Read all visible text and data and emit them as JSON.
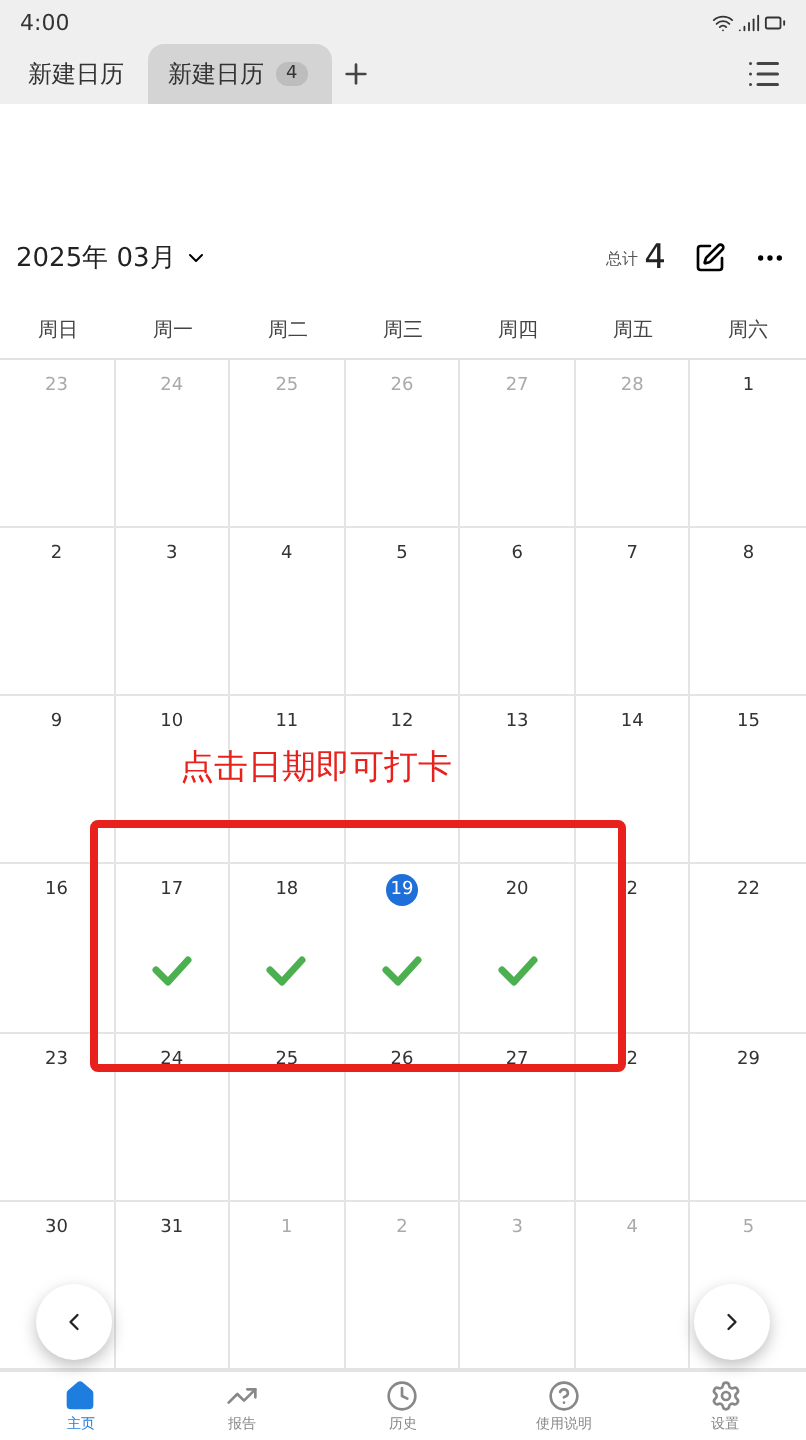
{
  "status_bar": {
    "time": "4:00"
  },
  "tabs": [
    {
      "label": "新建日历",
      "selected": false
    },
    {
      "label": "新建日历",
      "badge": "4",
      "selected": true
    }
  ],
  "header": {
    "month": "2025年 03月",
    "total_label": "总计",
    "total": "4"
  },
  "weekdays": [
    "周日",
    "周一",
    "周二",
    "周三",
    "周四",
    "周五",
    "周六"
  ],
  "weeks": [
    [
      {
        "day": "23",
        "in_month": false,
        "today": false,
        "checked": false
      },
      {
        "day": "24",
        "in_month": false,
        "today": false,
        "checked": false
      },
      {
        "day": "25",
        "in_month": false,
        "today": false,
        "checked": false
      },
      {
        "day": "26",
        "in_month": false,
        "today": false,
        "checked": false
      },
      {
        "day": "27",
        "in_month": false,
        "today": false,
        "checked": false
      },
      {
        "day": "28",
        "in_month": false,
        "today": false,
        "checked": false
      },
      {
        "day": "1",
        "in_month": true,
        "today": false,
        "checked": false
      }
    ],
    [
      {
        "day": "2",
        "in_month": true,
        "today": false,
        "checked": false
      },
      {
        "day": "3",
        "in_month": true,
        "today": false,
        "checked": false
      },
      {
        "day": "4",
        "in_month": true,
        "today": false,
        "checked": false
      },
      {
        "day": "5",
        "in_month": true,
        "today": false,
        "checked": false
      },
      {
        "day": "6",
        "in_month": true,
        "today": false,
        "checked": false
      },
      {
        "day": "7",
        "in_month": true,
        "today": false,
        "checked": false
      },
      {
        "day": "8",
        "in_month": true,
        "today": false,
        "checked": false
      }
    ],
    [
      {
        "day": "9",
        "in_month": true,
        "today": false,
        "checked": false
      },
      {
        "day": "10",
        "in_month": true,
        "today": false,
        "checked": false
      },
      {
        "day": "11",
        "in_month": true,
        "today": false,
        "checked": false
      },
      {
        "day": "12",
        "in_month": true,
        "today": false,
        "checked": false
      },
      {
        "day": "13",
        "in_month": true,
        "today": false,
        "checked": false
      },
      {
        "day": "14",
        "in_month": true,
        "today": false,
        "checked": false
      },
      {
        "day": "15",
        "in_month": true,
        "today": false,
        "checked": false
      }
    ],
    [
      {
        "day": "16",
        "in_month": true,
        "today": false,
        "checked": false
      },
      {
        "day": "17",
        "in_month": true,
        "today": false,
        "checked": true
      },
      {
        "day": "18",
        "in_month": true,
        "today": false,
        "checked": true
      },
      {
        "day": "19",
        "in_month": true,
        "today": true,
        "checked": true
      },
      {
        "day": "20",
        "in_month": true,
        "today": false,
        "checked": true
      },
      {
        "day": "2",
        "in_month": true,
        "today": false,
        "checked": false
      },
      {
        "day": "22",
        "in_month": true,
        "today": false,
        "checked": false
      }
    ],
    [
      {
        "day": "23",
        "in_month": true,
        "today": false,
        "checked": false
      },
      {
        "day": "24",
        "in_month": true,
        "today": false,
        "checked": false
      },
      {
        "day": "25",
        "in_month": true,
        "today": false,
        "checked": false
      },
      {
        "day": "26",
        "in_month": true,
        "today": false,
        "checked": false
      },
      {
        "day": "27",
        "in_month": true,
        "today": false,
        "checked": false
      },
      {
        "day": "2",
        "in_month": true,
        "today": false,
        "checked": false
      },
      {
        "day": "29",
        "in_month": true,
        "today": false,
        "checked": false
      }
    ],
    [
      {
        "day": "30",
        "in_month": true,
        "today": false,
        "checked": false
      },
      {
        "day": "31",
        "in_month": true,
        "today": false,
        "checked": false
      },
      {
        "day": "1",
        "in_month": false,
        "today": false,
        "checked": false
      },
      {
        "day": "2",
        "in_month": false,
        "today": false,
        "checked": false
      },
      {
        "day": "3",
        "in_month": false,
        "today": false,
        "checked": false
      },
      {
        "day": "4",
        "in_month": false,
        "today": false,
        "checked": false
      },
      {
        "day": "5",
        "in_month": false,
        "today": false,
        "checked": false
      }
    ]
  ],
  "annotation": {
    "text": "点击日期即可打卡"
  },
  "bottom_nav": [
    {
      "label": "主页",
      "kind": "home",
      "selected": true
    },
    {
      "label": "报告",
      "kind": "chart",
      "selected": false
    },
    {
      "label": "历史",
      "kind": "clock",
      "selected": false
    },
    {
      "label": "使用说明",
      "kind": "help",
      "selected": false
    },
    {
      "label": "设置",
      "kind": "gear",
      "selected": false
    }
  ]
}
